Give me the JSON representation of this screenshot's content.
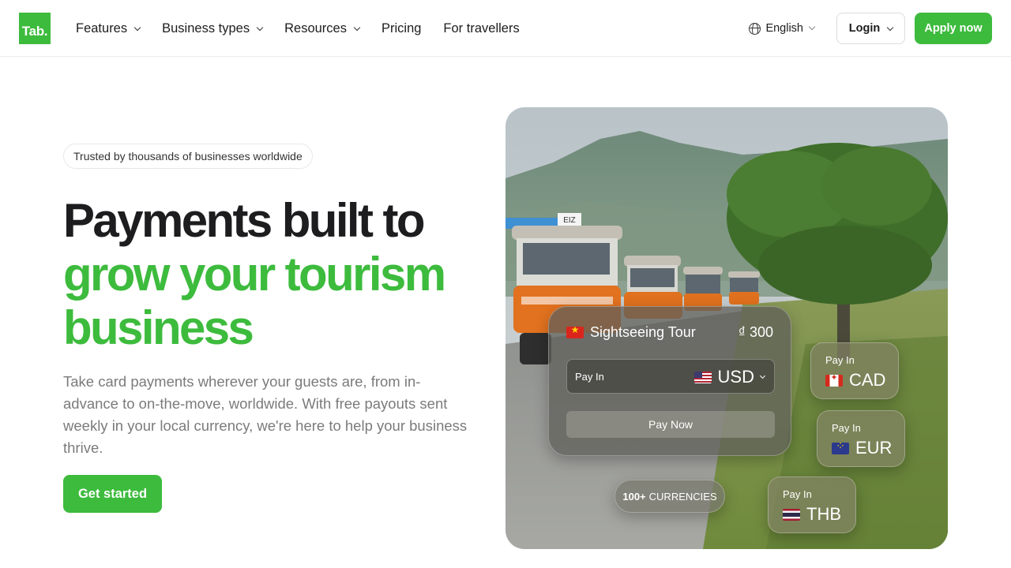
{
  "nav": {
    "logo": "Tab.",
    "links": [
      {
        "label": "Features",
        "dropdown": true
      },
      {
        "label": "Business types",
        "dropdown": true
      },
      {
        "label": "Resources",
        "dropdown": true
      },
      {
        "label": "Pricing",
        "dropdown": false
      },
      {
        "label": "For travellers",
        "dropdown": false
      }
    ],
    "language": "English",
    "login": "Login",
    "apply": "Apply now"
  },
  "hero": {
    "badge": "Trusted by thousands of businesses worldwide",
    "title_line1": "Payments built to",
    "title_line2": "grow your tourism",
    "title_line3": "business",
    "lead": "Take card payments wherever your guests are, from in-advance to on-the-move, worldwide. With free payouts sent weekly in your local currency, we're here to help your business thrive.",
    "cta": "Get started"
  },
  "colors": {
    "brand_green": "#3dbb3d",
    "heading": "#1d1d1f",
    "body_text": "#7b7b7b"
  },
  "widget": {
    "tour_name": "Sightseeing Tour",
    "tour_price": "₫ 300",
    "pay_in_label": "Pay In",
    "selected_currency": "USD",
    "pay_now": "Pay Now",
    "currencies_pill_bold": "100+",
    "currencies_pill_text": "CURRENCIES",
    "options": [
      {
        "label": "Pay In",
        "currency": "CAD",
        "flag": "canada-flag"
      },
      {
        "label": "Pay In",
        "currency": "EUR",
        "flag": "eu-flag"
      },
      {
        "label": "Pay In",
        "currency": "THB",
        "flag": "thailand-flag"
      }
    ],
    "tuktuk_plate": "EIZ"
  }
}
